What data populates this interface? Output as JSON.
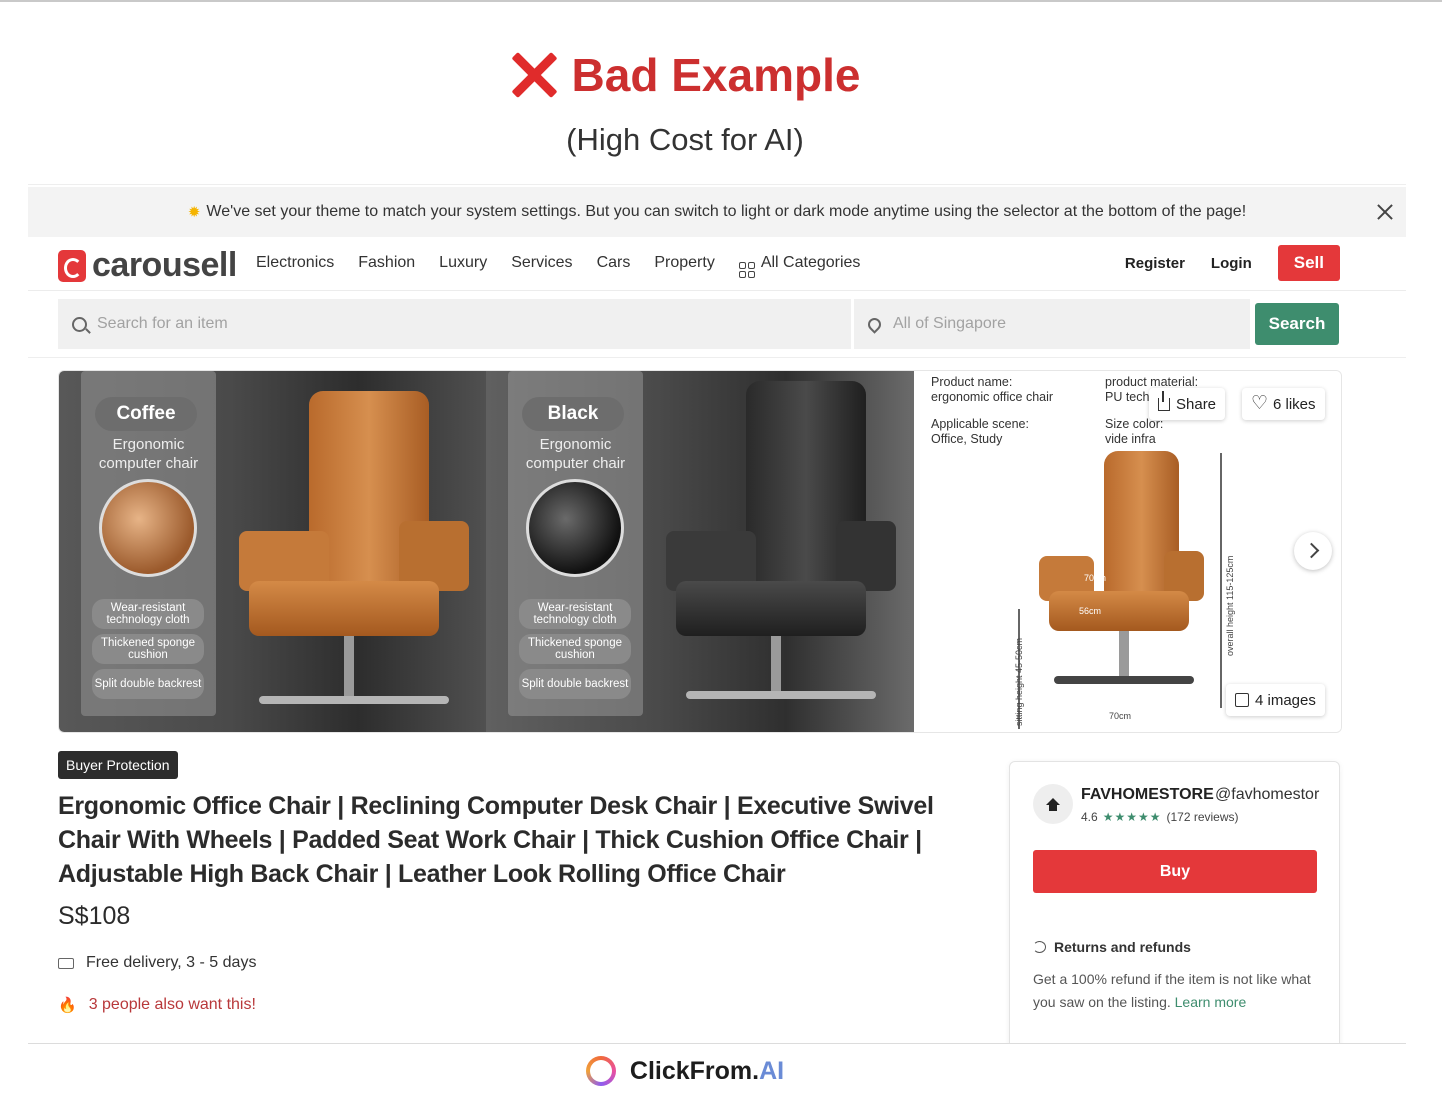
{
  "heading": {
    "title": "Bad Example",
    "subtitle": "(High Cost for AI)"
  },
  "banner": {
    "message": "We've set your theme to match your system settings. But you can switch to light or dark mode anytime using the selector at the bottom of the page!"
  },
  "nav": {
    "logo": "carousell",
    "links": [
      "Electronics",
      "Fashion",
      "Luxury",
      "Services",
      "Cars",
      "Property"
    ],
    "all_categories": "All Categories",
    "register": "Register",
    "login": "Login",
    "sell": "Sell"
  },
  "search": {
    "placeholder": "Search for an item",
    "location_placeholder": "All of Singapore",
    "button": "Search"
  },
  "gallery": {
    "photo1": {
      "color": "Coffee",
      "subtitle": "Ergonomic computer chair",
      "features": [
        "Wear-resistant technology cloth",
        "Thickened sponge cushion",
        "Split double backrest"
      ]
    },
    "photo2": {
      "color": "Black",
      "subtitle": "Ergonomic computer chair",
      "features": [
        "Wear-resistant technology cloth",
        "Thickened sponge cushion",
        "Split double backrest"
      ]
    },
    "photo3": {
      "product_name_label": "Product name:",
      "product_name": "ergonomic office chair",
      "scene_label": "Applicable scene:",
      "scene": "Office, Study",
      "material_label": "product material:",
      "material": "PU tech",
      "size_label": "Size color:",
      "size": "vide infra",
      "dims": {
        "overall": "overall height 115-125cm",
        "sitting": "sitting height 45-50cm",
        "width1": "70cm",
        "width2": "56cm",
        "base": "70cm"
      }
    },
    "share": "Share",
    "likes": "6 likes",
    "images": "4 images"
  },
  "listing": {
    "badge": "Buyer Protection",
    "title": "Ergonomic Office Chair | Reclining Computer Desk Chair | Executive Swivel Chair With Wheels | Padded Seat Work Chair | Thick Cushion Office Chair | Adjustable High Back Chair | Leather Look Rolling Office Chair",
    "price": "S$108",
    "delivery": "Free delivery, 3 - 5 days",
    "want": "3 people also want this!"
  },
  "seller": {
    "name": "FAVHOMESTORE",
    "handle": "@favhomestor",
    "rating": "4.6",
    "reviews": "(172 reviews)",
    "buy": "Buy",
    "returns_title": "Returns and refunds",
    "refund_text": "Get a 100% refund if the item is not like what you saw on the listing.",
    "learn_more": "Learn more"
  },
  "footer": {
    "brand": "ClickFrom.",
    "brand_ai": "AI"
  },
  "colors": {
    "accent_red": "#e4383a",
    "accent_green": "#3e8d6e",
    "heading_red": "#cc2f2f"
  }
}
